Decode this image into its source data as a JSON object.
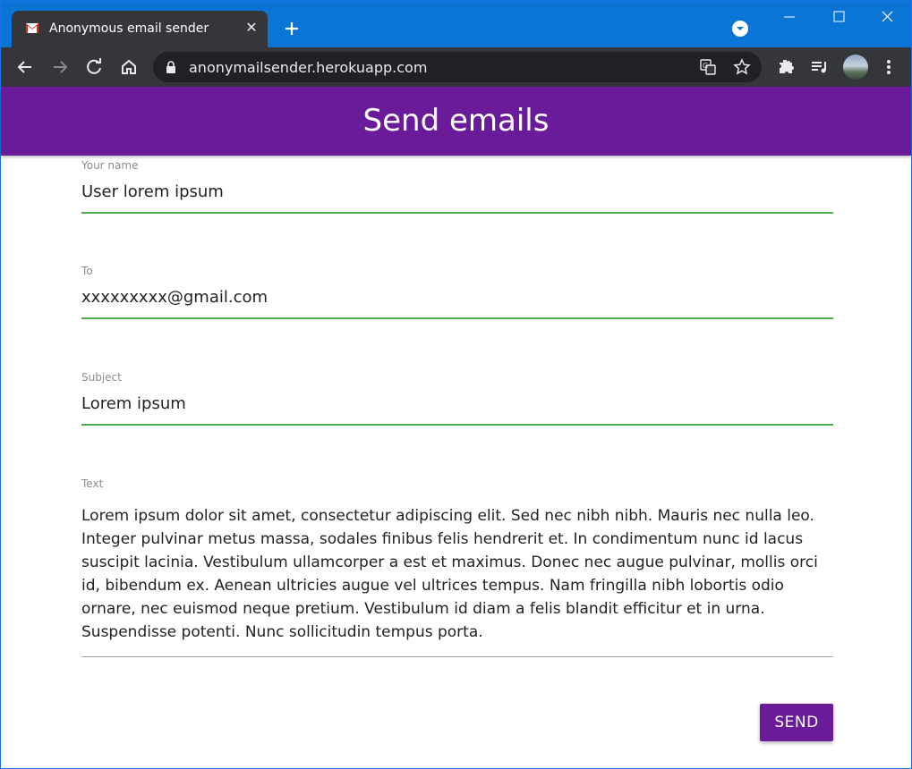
{
  "browser": {
    "tab_title": "Anonymous email sender",
    "url": "anonymailsender.herokuapp.com"
  },
  "header": {
    "title": "Send emails"
  },
  "form": {
    "name": {
      "label": "Your name",
      "value": "User lorem ipsum"
    },
    "to": {
      "label": "To",
      "value": "xxxxxxxxx@gmail.com"
    },
    "subject": {
      "label": "Subject",
      "value": "Lorem ipsum"
    },
    "text": {
      "label": "Text",
      "value": "Lorem ipsum dolor sit amet, consectetur adipiscing elit. Sed nec nibh nibh. Mauris nec nulla leo. Integer pulvinar metus massa, sodales finibus felis hendrerit et. In condimentum nunc id lacus suscipit lacinia. Vestibulum ullamcorper a est et maximus. Donec nec augue pulvinar, mollis orci id, bibendum ex. Aenean ultricies augue vel ultrices tempus. Nam fringilla nibh lobortis odio ornare, nec euismod neque pretium. Vestibulum id diam a felis blandit efficitur et in urna. Suspendisse potenti. Nunc sollicitudin tempus porta."
    },
    "send_label": "SEND"
  },
  "colors": {
    "titlebar": "#0a75d5",
    "header": "#6a1b9a",
    "field_underline": "#4caf50"
  }
}
